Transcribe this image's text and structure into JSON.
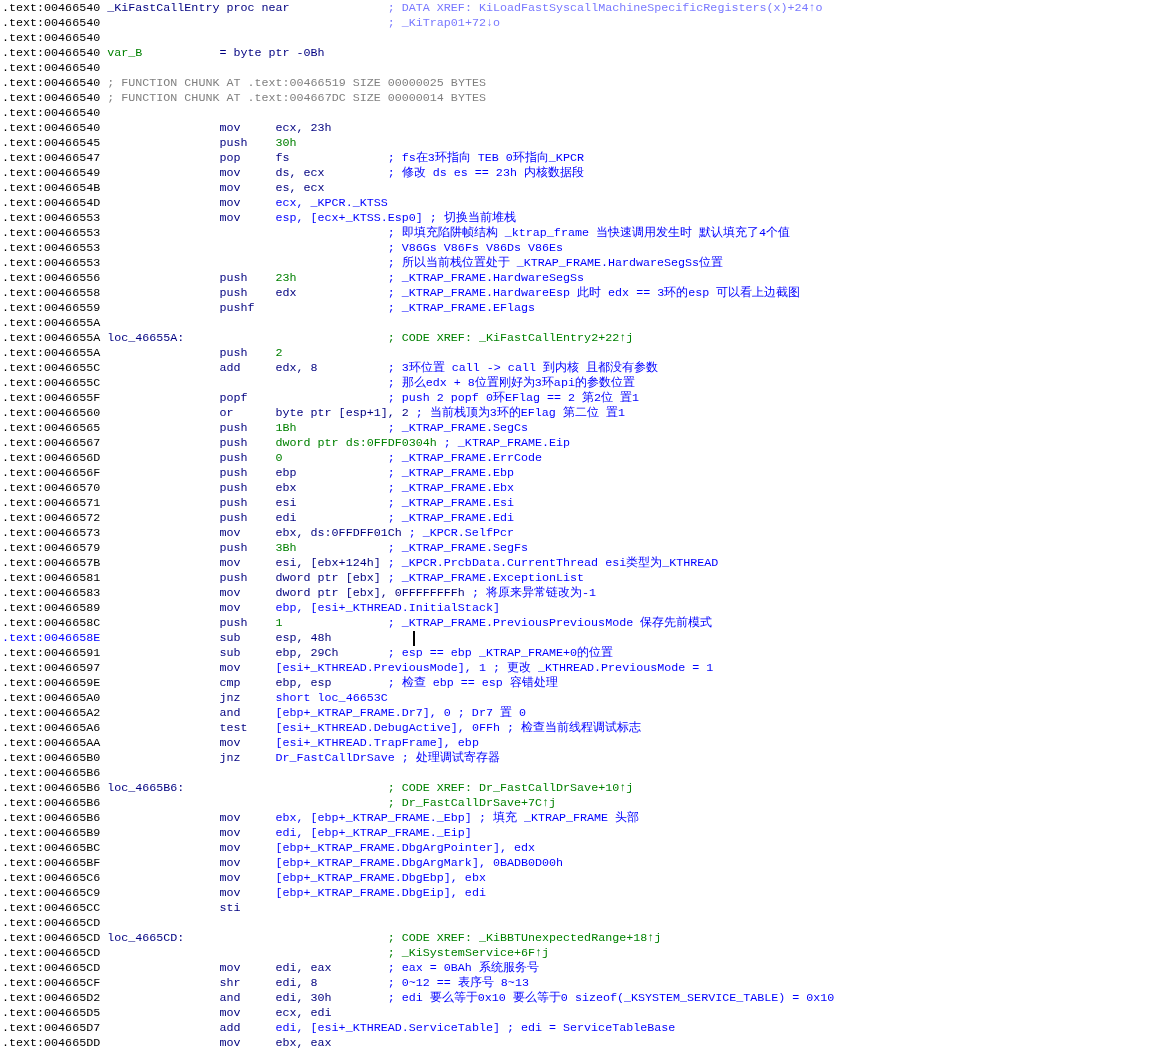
{
  "lines": [
    {
      "address": ".text:00466540",
      "kind": "proc",
      "label": "_KiFastCallEntry proc near",
      "comment": {
        "kind": "data_xref",
        "text": "; DATA XREF: KiLoadFastSyscallMachineSpecificRegisters(x)+24↑o"
      },
      "selected": false
    },
    {
      "address": ".text:00466540",
      "kind": "comment",
      "comment": {
        "kind": "data_xref",
        "text": "; _KiTrap01+72↓o"
      },
      "selected": false
    },
    {
      "address": ".text:00466540",
      "kind": "blank",
      "selected": false
    },
    {
      "address": ".text:00466540",
      "kind": "var",
      "label": "var_B",
      "definition": "= byte ptr -0Bh",
      "selected": false
    },
    {
      "address": ".text:00466540",
      "kind": "blank",
      "selected": false
    },
    {
      "address": ".text:00466540",
      "kind": "chunk",
      "comment": {
        "kind": "chunk",
        "text": "; FUNCTION CHUNK AT .text:00466519 SIZE 00000025 BYTES"
      },
      "selected": false
    },
    {
      "address": ".text:00466540",
      "kind": "chunk",
      "comment": {
        "kind": "chunk",
        "text": "; FUNCTION CHUNK AT .text:004667DC SIZE 00000014 BYTES"
      },
      "selected": false
    },
    {
      "address": ".text:00466540",
      "kind": "blank",
      "selected": false
    },
    {
      "address": ".text:00466540",
      "kind": "instr",
      "mnemonic": "mov",
      "operands": {
        "kind": "register",
        "text": "ecx, 23h"
      },
      "selected": false
    },
    {
      "address": ".text:00466545",
      "kind": "instr",
      "mnemonic": "push",
      "operands": {
        "kind": "number",
        "text": "30h"
      },
      "selected": false
    },
    {
      "address": ".text:00466547",
      "kind": "instr",
      "mnemonic": "pop",
      "operands": {
        "kind": "register",
        "text": "fs"
      },
      "comment": {
        "kind": "user",
        "text": "; fs在3环指向 TEB 0环指向_KPCR"
      },
      "selected": false
    },
    {
      "address": ".text:00466549",
      "kind": "instr",
      "mnemonic": "mov",
      "operands": {
        "kind": "register",
        "text": "ds, ecx"
      },
      "comment": {
        "kind": "user",
        "text": "; 修改 ds es == 23h 内核数据段"
      },
      "selected": false
    },
    {
      "address": ".text:0046654B",
      "kind": "instr",
      "mnemonic": "mov",
      "operands": {
        "kind": "register",
        "text": "es, ecx"
      },
      "selected": false
    },
    {
      "address": ".text:0046654D",
      "kind": "instr",
      "mnemonic": "mov",
      "operands": {
        "kind": "symbol",
        "text": "ecx, _KPCR._KTSS"
      },
      "selected": false
    },
    {
      "address": ".text:00466553",
      "kind": "instr",
      "mnemonic": "mov",
      "operands": {
        "kind": "symbol",
        "text": "esp, [ecx+_KTSS.Esp0]"
      },
      "comment": {
        "kind": "user",
        "text": "; 切换当前堆栈"
      },
      "selected": false
    },
    {
      "address": ".text:00466553",
      "kind": "comment",
      "comment": {
        "kind": "user",
        "text": "; 即填充陷阱帧结构 _ktrap_frame 当快速调用发生时 默认填充了4个值"
      },
      "selected": false
    },
    {
      "address": ".text:00466553",
      "kind": "comment",
      "comment": {
        "kind": "user",
        "text": "; V86Gs V86Fs V86Ds V86Es"
      },
      "selected": false
    },
    {
      "address": ".text:00466553",
      "kind": "comment",
      "comment": {
        "kind": "user",
        "text": "; 所以当前栈位置处于 _KTRAP_FRAME.HardwareSegSs位置"
      },
      "selected": false
    },
    {
      "address": ".text:00466556",
      "kind": "instr",
      "mnemonic": "push",
      "operands": {
        "kind": "number",
        "text": "23h"
      },
      "comment": {
        "kind": "user",
        "text": "; _KTRAP_FRAME.HardwareSegSs"
      },
      "selected": false
    },
    {
      "address": ".text:00466558",
      "kind": "instr",
      "mnemonic": "push",
      "operands": {
        "kind": "register",
        "text": "edx"
      },
      "comment": {
        "kind": "user",
        "text": "; _KTRAP_FRAME.HardwareEsp 此时 edx == 3环的esp 可以看上边截图"
      },
      "selected": false
    },
    {
      "address": ".text:00466559",
      "kind": "instr",
      "mnemonic": "pushf",
      "comment": {
        "kind": "user",
        "text": "; _KTRAP_FRAME.EFlags"
      },
      "selected": false
    },
    {
      "address": ".text:0046655A",
      "kind": "blank",
      "selected": false
    },
    {
      "address": ".text:0046655A",
      "kind": "label",
      "label": "loc_46655A:",
      "comment": {
        "kind": "code_xref",
        "text": "; CODE XREF: _KiFastCallEntry2+22↑j"
      },
      "selected": false
    },
    {
      "address": ".text:0046655A",
      "kind": "instr",
      "mnemonic": "push",
      "operands": {
        "kind": "number",
        "text": "2"
      },
      "selected": false
    },
    {
      "address": ".text:0046655C",
      "kind": "instr",
      "mnemonic": "add",
      "operands": {
        "kind": "register",
        "text": "edx, 8"
      },
      "comment": {
        "kind": "user",
        "text": "; 3环位置 call -> call 到内核 且都没有参数"
      },
      "selected": false
    },
    {
      "address": ".text:0046655C",
      "kind": "comment",
      "comment": {
        "kind": "user",
        "text": "; 那么edx + 8位置刚好为3环api的参数位置"
      },
      "selected": false
    },
    {
      "address": ".text:0046655F",
      "kind": "instr",
      "mnemonic": "popf",
      "comment": {
        "kind": "user",
        "text": "; push 2 popf 0环EFlag == 2 第2位 置1"
      },
      "selected": false
    },
    {
      "address": ".text:00466560",
      "kind": "instr",
      "mnemonic": "or",
      "operands": {
        "kind": "register",
        "text": "byte ptr [esp+1], 2"
      },
      "comment": {
        "kind": "user",
        "text": "; 当前栈顶为3环的EFlag 第二位 置1"
      },
      "selected": false
    },
    {
      "address": ".text:00466565",
      "kind": "instr",
      "mnemonic": "push",
      "operands": {
        "kind": "number",
        "text": "1Bh"
      },
      "comment": {
        "kind": "user",
        "text": "; _KTRAP_FRAME.SegCs"
      },
      "selected": false
    },
    {
      "address": ".text:00466567",
      "kind": "instr",
      "mnemonic": "push",
      "operands": {
        "kind": "number",
        "text": "dword ptr ds:0FFDF0304h"
      },
      "comment": {
        "kind": "user",
        "text": "; _KTRAP_FRAME.Eip"
      },
      "selected": false
    },
    {
      "address": ".text:0046656D",
      "kind": "instr",
      "mnemonic": "push",
      "operands": {
        "kind": "number",
        "text": "0"
      },
      "comment": {
        "kind": "user",
        "text": "; _KTRAP_FRAME.ErrCode"
      },
      "selected": false
    },
    {
      "address": ".text:0046656F",
      "kind": "instr",
      "mnemonic": "push",
      "operands": {
        "kind": "register",
        "text": "ebp"
      },
      "comment": {
        "kind": "user",
        "text": "; _KTRAP_FRAME.Ebp"
      },
      "selected": false
    },
    {
      "address": ".text:00466570",
      "kind": "instr",
      "mnemonic": "push",
      "operands": {
        "kind": "register",
        "text": "ebx"
      },
      "comment": {
        "kind": "user",
        "text": "; _KTRAP_FRAME.Ebx"
      },
      "selected": false
    },
    {
      "address": ".text:00466571",
      "kind": "instr",
      "mnemonic": "push",
      "operands": {
        "kind": "register",
        "text": "esi"
      },
      "comment": {
        "kind": "user",
        "text": "; _KTRAP_FRAME.Esi"
      },
      "selected": false
    },
    {
      "address": ".text:00466572",
      "kind": "instr",
      "mnemonic": "push",
      "operands": {
        "kind": "register",
        "text": "edi"
      },
      "comment": {
        "kind": "user",
        "text": "; _KTRAP_FRAME.Edi"
      },
      "selected": false
    },
    {
      "address": ".text:00466573",
      "kind": "instr",
      "mnemonic": "mov",
      "operands": {
        "kind": "register",
        "text": "ebx, ds:0FFDFF01Ch"
      },
      "comment": {
        "kind": "user",
        "text": "; _KPCR.SelfPcr"
      },
      "selected": false
    },
    {
      "address": ".text:00466579",
      "kind": "instr",
      "mnemonic": "push",
      "operands": {
        "kind": "number",
        "text": "3Bh"
      },
      "comment": {
        "kind": "user",
        "text": "; _KTRAP_FRAME.SegFs"
      },
      "selected": false
    },
    {
      "address": ".text:0046657B",
      "kind": "instr",
      "mnemonic": "mov",
      "operands": {
        "kind": "register",
        "text": "esi, [ebx+124h]"
      },
      "comment": {
        "kind": "user",
        "text": "; _KPCR.PrcbData.CurrentThread esi类型为_KTHREAD"
      },
      "selected": false
    },
    {
      "address": ".text:00466581",
      "kind": "instr",
      "mnemonic": "push",
      "operands": {
        "kind": "register",
        "text": "dword ptr [ebx]"
      },
      "comment": {
        "kind": "user",
        "text": "; _KTRAP_FRAME.ExceptionList"
      },
      "selected": false
    },
    {
      "address": ".text:00466583",
      "kind": "instr",
      "mnemonic": "mov",
      "operands": {
        "kind": "register",
        "text": "dword ptr [ebx], 0FFFFFFFFh"
      },
      "comment": {
        "kind": "user",
        "text": "; 将原来异常链改为-1"
      },
      "selected": false
    },
    {
      "address": ".text:00466589",
      "kind": "instr",
      "mnemonic": "mov",
      "operands": {
        "kind": "symbol",
        "text": "ebp, [esi+_KTHREAD.InitialStack]"
      },
      "selected": false
    },
    {
      "address": ".text:0046658C",
      "kind": "instr",
      "mnemonic": "push",
      "operands": {
        "kind": "number",
        "text": "1"
      },
      "comment": {
        "kind": "user",
        "text": "; _KTRAP_FRAME.PreviousPreviousMode 保存先前模式"
      },
      "selected": false
    },
    {
      "address": ".text:0046658E",
      "kind": "instr",
      "mnemonic": "sub",
      "operands": {
        "kind": "register",
        "text": "esp, 48h"
      },
      "selected": true
    },
    {
      "address": ".text:00466591",
      "kind": "instr",
      "mnemonic": "sub",
      "operands": {
        "kind": "register",
        "text": "ebp, 29Ch"
      },
      "comment": {
        "kind": "user",
        "text": "; esp == ebp _KTRAP_FRAME+0的位置"
      },
      "selected": false
    },
    {
      "address": ".text:00466597",
      "kind": "instr",
      "mnemonic": "mov",
      "operands": {
        "kind": "symbol",
        "text": "[esi+_KTHREAD.PreviousMode], 1"
      },
      "comment": {
        "kind": "user",
        "text": "; 更改 _KTHREAD.PreviousMode = 1"
      },
      "selected": false
    },
    {
      "address": ".text:0046659E",
      "kind": "instr",
      "mnemonic": "cmp",
      "operands": {
        "kind": "register",
        "text": "ebp, esp"
      },
      "comment": {
        "kind": "user",
        "text": "; 检查 ebp == esp 容错处理"
      },
      "selected": false
    },
    {
      "address": ".text:004665A0",
      "kind": "instr",
      "mnemonic": "jnz",
      "operands": {
        "kind": "symbol",
        "text": "short loc_46653C"
      },
      "selected": false
    },
    {
      "address": ".text:004665A2",
      "kind": "instr",
      "mnemonic": "and",
      "operands": {
        "kind": "symbol",
        "text": "[ebp+_KTRAP_FRAME.Dr7], 0"
      },
      "comment": {
        "kind": "user",
        "text": "; Dr7 置 0"
      },
      "selected": false
    },
    {
      "address": ".text:004665A6",
      "kind": "instr",
      "mnemonic": "test",
      "operands": {
        "kind": "symbol",
        "text": "[esi+_KTHREAD.DebugActive], 0FFh"
      },
      "comment": {
        "kind": "user",
        "text": "; 检查当前线程调试标志"
      },
      "selected": false
    },
    {
      "address": ".text:004665AA",
      "kind": "instr",
      "mnemonic": "mov",
      "operands": {
        "kind": "symbol",
        "text": "[esi+_KTHREAD.TrapFrame], ebp"
      },
      "selected": false
    },
    {
      "address": ".text:004665B0",
      "kind": "instr",
      "mnemonic": "jnz",
      "operands": {
        "kind": "symbol",
        "text": "Dr_FastCallDrSave"
      },
      "comment": {
        "kind": "user",
        "text": "; 处理调试寄存器"
      },
      "selected": false
    },
    {
      "address": ".text:004665B6",
      "kind": "blank",
      "selected": false
    },
    {
      "address": ".text:004665B6",
      "kind": "label",
      "label": "loc_4665B6:",
      "comment": {
        "kind": "code_xref",
        "text": "; CODE XREF: Dr_FastCallDrSave+10↑j"
      },
      "selected": false
    },
    {
      "address": ".text:004665B6",
      "kind": "comment",
      "comment": {
        "kind": "code_xref",
        "text": "; Dr_FastCallDrSave+7C↑j"
      },
      "selected": false
    },
    {
      "address": ".text:004665B6",
      "kind": "instr",
      "mnemonic": "mov",
      "operands": {
        "kind": "symbol",
        "text": "ebx, [ebp+_KTRAP_FRAME._Ebp]"
      },
      "comment": {
        "kind": "user",
        "text": "; 填充 _KTRAP_FRAME 头部"
      },
      "selected": false
    },
    {
      "address": ".text:004665B9",
      "kind": "instr",
      "mnemonic": "mov",
      "operands": {
        "kind": "symbol",
        "text": "edi, [ebp+_KTRAP_FRAME._Eip]"
      },
      "selected": false
    },
    {
      "address": ".text:004665BC",
      "kind": "instr",
      "mnemonic": "mov",
      "operands": {
        "kind": "symbol",
        "text": "[ebp+_KTRAP_FRAME.DbgArgPointer], edx"
      },
      "selected": false
    },
    {
      "address": ".text:004665BF",
      "kind": "instr",
      "mnemonic": "mov",
      "operands": {
        "kind": "symbol",
        "text": "[ebp+_KTRAP_FRAME.DbgArgMark], 0BADB0D00h"
      },
      "selected": false
    },
    {
      "address": ".text:004665C6",
      "kind": "instr",
      "mnemonic": "mov",
      "operands": {
        "kind": "symbol",
        "text": "[ebp+_KTRAP_FRAME.DbgEbp], ebx"
      },
      "selected": false
    },
    {
      "address": ".text:004665C9",
      "kind": "instr",
      "mnemonic": "mov",
      "operands": {
        "kind": "symbol",
        "text": "[ebp+_KTRAP_FRAME.DbgEip], edi"
      },
      "selected": false
    },
    {
      "address": ".text:004665CC",
      "kind": "instr",
      "mnemonic": "sti",
      "selected": false
    },
    {
      "address": ".text:004665CD",
      "kind": "blank",
      "selected": false
    },
    {
      "address": ".text:004665CD",
      "kind": "label",
      "label": "loc_4665CD:",
      "comment": {
        "kind": "code_xref",
        "text": "; CODE XREF: _KiBBTUnexpectedRange+18↑j"
      },
      "selected": false
    },
    {
      "address": ".text:004665CD",
      "kind": "comment",
      "comment": {
        "kind": "code_xref",
        "text": "; _KiSystemService+6F↑j"
      },
      "selected": false
    },
    {
      "address": ".text:004665CD",
      "kind": "instr",
      "mnemonic": "mov",
      "operands": {
        "kind": "register",
        "text": "edi, eax"
      },
      "comment": {
        "kind": "user",
        "text": "; eax = 0BAh 系统服务号"
      },
      "selected": false
    },
    {
      "address": ".text:004665CF",
      "kind": "instr",
      "mnemonic": "shr",
      "operands": {
        "kind": "register",
        "text": "edi, 8"
      },
      "comment": {
        "kind": "user",
        "text": "; 0~12 == 表序号 8~13"
      },
      "selected": false
    },
    {
      "address": ".text:004665D2",
      "kind": "instr",
      "mnemonic": "and",
      "operands": {
        "kind": "register",
        "text": "edi, 30h"
      },
      "comment": {
        "kind": "user",
        "text": "; edi 要么等于0x10 要么等于0 sizeof(_KSYSTEM_SERVICE_TABLE) = 0x10"
      },
      "selected": false
    },
    {
      "address": ".text:004665D5",
      "kind": "instr",
      "mnemonic": "mov",
      "operands": {
        "kind": "register",
        "text": "ecx, edi"
      },
      "selected": false
    },
    {
      "address": ".text:004665D7",
      "kind": "instr",
      "mnemonic": "add",
      "operands": {
        "kind": "symbol",
        "text": "edi, [esi+_KTHREAD.ServiceTable]"
      },
      "comment": {
        "kind": "user",
        "text": "; edi = ServiceTableBase"
      },
      "selected": false
    },
    {
      "address": ".text:004665DD",
      "kind": "instr",
      "mnemonic": "mov",
      "operands": {
        "kind": "register",
        "text": "ebx, eax"
      },
      "selected": false
    }
  ]
}
